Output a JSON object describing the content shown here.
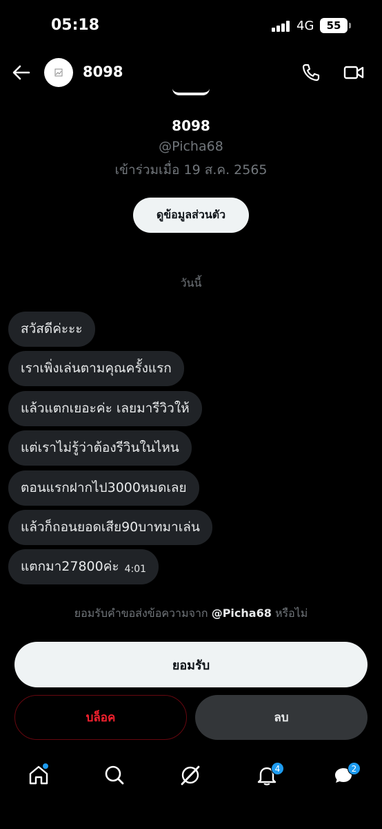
{
  "status_bar": {
    "time": "05:18",
    "network": "4G",
    "battery": "55"
  },
  "header": {
    "name": "8098",
    "back_icon": "arrow-left-icon",
    "call_icon": "phone-icon",
    "video_icon": "video-camera-icon"
  },
  "profile": {
    "name": "8098",
    "handle": "@Picha68",
    "joined": "เข้าร่วมเมื่อ 19 ส.ค. 2565",
    "view_profile_label": "ดูข้อมูลส่วนตัว"
  },
  "date_separator": "วันนี้",
  "messages": [
    {
      "text": "สวัสดีค่ะะะ"
    },
    {
      "text": "เราเพิ่งเล่นตามคุณครั้งแรก"
    },
    {
      "text": "แล้วแตกเยอะค่ะ เลยมารีวิวให้"
    },
    {
      "text": "แต่เราไม่รู้ว่าต้องรีวินในไหน"
    },
    {
      "text": "ตอนแรกฝากไป3000หมดเลย"
    },
    {
      "text": "แล้วก็ถอนยอดเสีย90บาทมาเล่น"
    },
    {
      "text": "แตกมา27800ค่ะ",
      "time": "4:01"
    }
  ],
  "request": {
    "prefix": "ยอมรับคำขอส่งข้อความจาก",
    "handle": "@Picha68",
    "suffix": "หรือไม่"
  },
  "actions": {
    "accept": "ยอมรับ",
    "block": "บล็อค",
    "delete": "ลบ"
  },
  "tab_bar": {
    "items": [
      {
        "icon": "home-icon"
      },
      {
        "icon": "search-icon"
      },
      {
        "icon": "grok-icon"
      },
      {
        "icon": "bell-icon",
        "badge": "4"
      },
      {
        "icon": "messages-icon",
        "badge": "2"
      }
    ]
  },
  "colors": {
    "background": "#000000",
    "bubble": "#202327",
    "accent": "#1d9bf0",
    "danger": "#f4212e",
    "muted": "#71767b"
  }
}
